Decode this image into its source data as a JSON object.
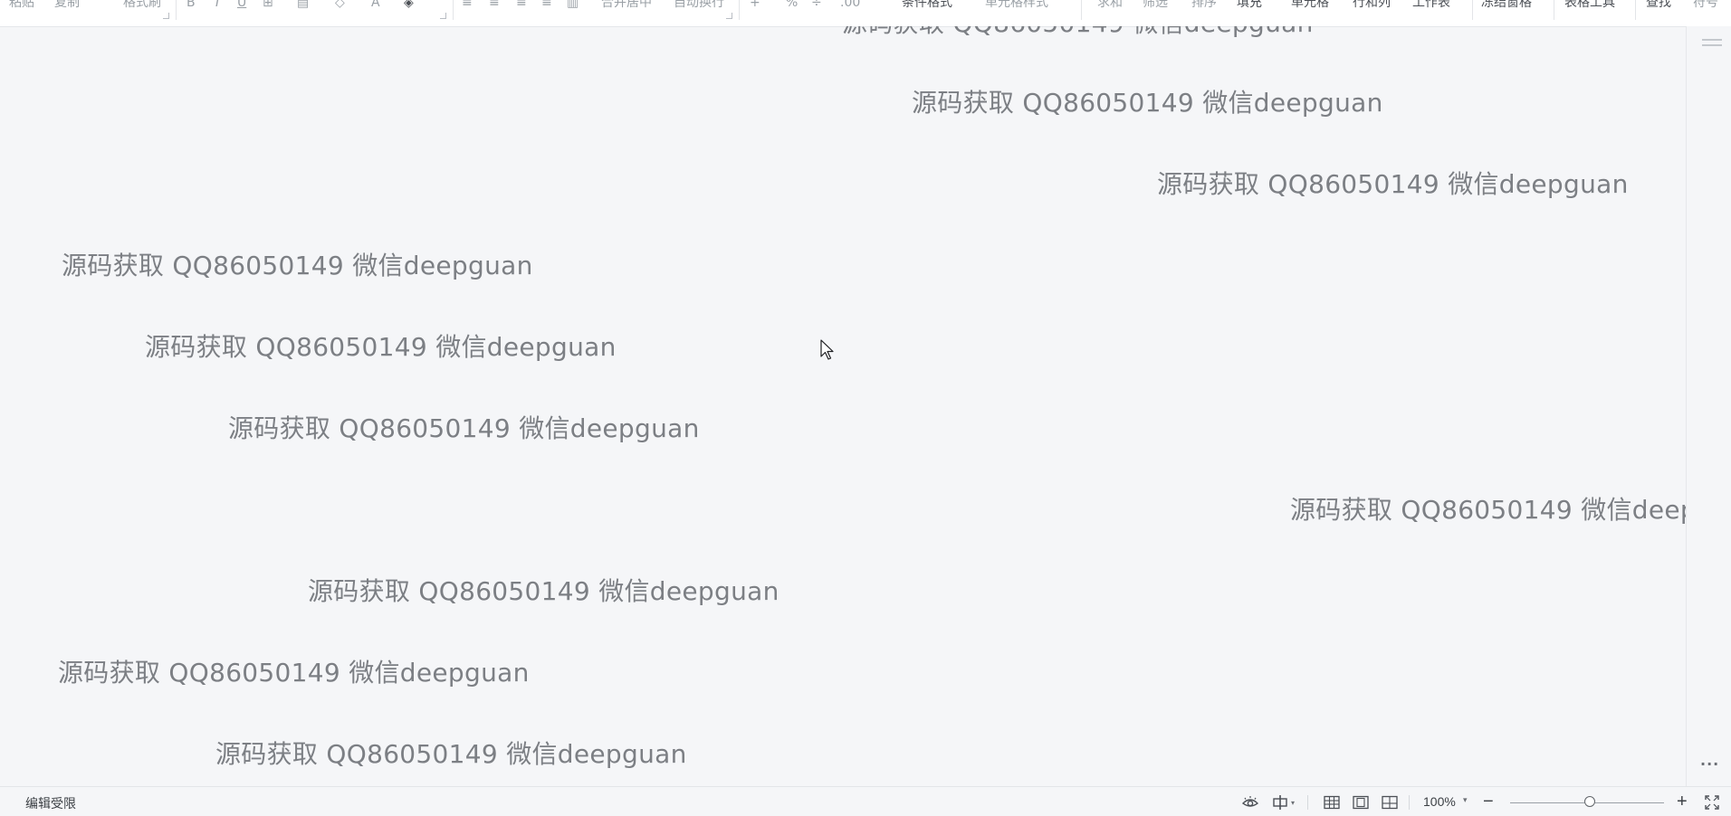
{
  "toolbar": {
    "items": [
      "粘贴",
      "复制",
      "格式刷",
      "B",
      "I",
      "U",
      "⊞",
      "▤",
      "◇",
      "A",
      "◈",
      "≡",
      "≡",
      "≡",
      "≡",
      "▥",
      "合并居中",
      "自动换行",
      "+",
      "%",
      "÷",
      ".00",
      "条件格式",
      "单元格样式",
      "求和",
      "筛选",
      "排序",
      "填充",
      "单元格",
      "行和列",
      "工作表",
      "冻结窗格",
      "表格工具",
      "查找",
      "符号"
    ]
  },
  "watermark": {
    "text": "源码获取 QQ86050149 微信deepguan"
  },
  "statusbar": {
    "left_text": "编辑受限",
    "zoom_value": "100%",
    "zoom_fraction": 0.52,
    "zoom_out": "−",
    "zoom_in": "+"
  },
  "icons": {
    "eye": "eye-icon",
    "lang": "chinese-input-icon",
    "normal_view": "normal-view-icon",
    "page_layout": "page-layout-view-icon",
    "page_break": "page-break-view-icon",
    "fullscreen": "fullscreen-icon",
    "more": "more-options-icon"
  }
}
